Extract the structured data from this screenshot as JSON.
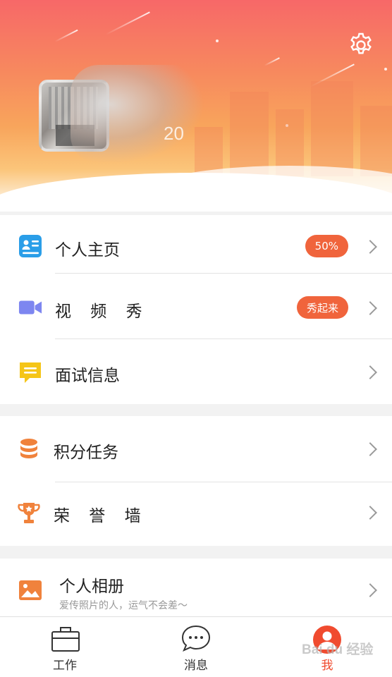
{
  "header": {
    "uid_text": "20",
    "settings_icon": "gear-icon"
  },
  "menu_group_1": [
    {
      "label": "个人主页",
      "icon": "profile-card-icon",
      "badge": "50%",
      "color": "#2a9ee8"
    },
    {
      "label": "视 频 秀",
      "icon": "video-camera-icon",
      "badge": "秀起来",
      "color": "#7d86f0"
    },
    {
      "label": "面试信息",
      "icon": "chat-bubble-icon",
      "badge": "",
      "color": "#f5c518"
    }
  ],
  "menu_group_2": [
    {
      "label": "积分任务",
      "icon": "coin-stack-icon",
      "color": "#f0823c"
    },
    {
      "label": "荣 誉 墙",
      "icon": "trophy-icon",
      "color": "#f0823c"
    }
  ],
  "menu_group_3": [
    {
      "label": "个人相册",
      "sublabel": "爱传照片的人，运气不会差～",
      "icon": "photo-album-icon",
      "color": "#f0823c"
    }
  ],
  "bottom_nav": [
    {
      "label": "工作",
      "icon": "briefcase-icon"
    },
    {
      "label": "消息",
      "icon": "message-bubble-icon"
    },
    {
      "label": "我",
      "icon": "user-icon",
      "active": true
    }
  ],
  "watermark": "Bai du 经验",
  "colors": {
    "accent": "#f04b2f",
    "badge": "#f0643c"
  }
}
